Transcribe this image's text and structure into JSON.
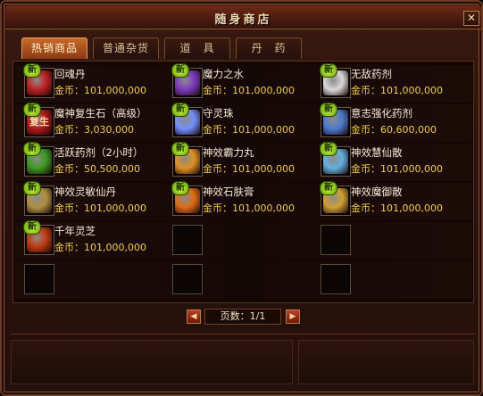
{
  "window": {
    "title": "随身商店",
    "close_glyph": "✕"
  },
  "tabs": [
    {
      "label": "热销商品",
      "active": true
    },
    {
      "label": "普通杂货",
      "active": false
    },
    {
      "label": "道　具",
      "active": false
    },
    {
      "label": "丹　药",
      "active": false
    }
  ],
  "currency_label": "金币：",
  "new_badge": "新",
  "items": [
    {
      "name": "回魂丹",
      "price": "101,000,000",
      "icon": "red-pill-icon",
      "color": "#c02020"
    },
    {
      "name": "魔力之水",
      "price": "101,000,000",
      "icon": "purple-potion-icon",
      "color": "#7a3ac0"
    },
    {
      "name": "无敌药剂",
      "price": "101,000,000",
      "icon": "white-bottle-icon",
      "color": "#d8d8d8"
    },
    {
      "name": "魔神复生石（高级）",
      "price": "3,030,000",
      "icon": "red-revive-stone-icon",
      "color": "#b01818",
      "icon_text": "复生"
    },
    {
      "name": "守灵珠",
      "price": "101,000,000",
      "icon": "blue-orb-icon",
      "color": "#7090ff"
    },
    {
      "name": "意志强化药剂",
      "price": "60,600,000",
      "icon": "blue-potion-icon",
      "color": "#4a7ad0"
    },
    {
      "name": "活跃药剂（2小时）",
      "price": "50,500,000",
      "icon": "green-potion-icon",
      "color": "#3a9a20"
    },
    {
      "name": "神效霸力丸",
      "price": "101,000,000",
      "icon": "golden-pills-icon",
      "color": "#e09020"
    },
    {
      "name": "神效慧仙散",
      "price": "101,000,000",
      "icon": "blue-crystal-icon",
      "color": "#60b0e0"
    },
    {
      "name": "神效灵敏仙丹",
      "price": "101,000,000",
      "icon": "scroll-icon",
      "color": "#b09040"
    },
    {
      "name": "神效石肤膏",
      "price": "101,000,000",
      "icon": "orange-salve-icon",
      "color": "#e06a10"
    },
    {
      "name": "神效魔御散",
      "price": "101,000,000",
      "icon": "gold-horn-icon",
      "color": "#d0a030"
    },
    {
      "name": "千年灵芝",
      "price": "101,000,000",
      "icon": "red-mushroom-icon",
      "color": "#c03a10"
    }
  ],
  "pager": {
    "prev_glyph": "◀",
    "next_glyph": "▶",
    "label": "页数：1/1"
  }
}
